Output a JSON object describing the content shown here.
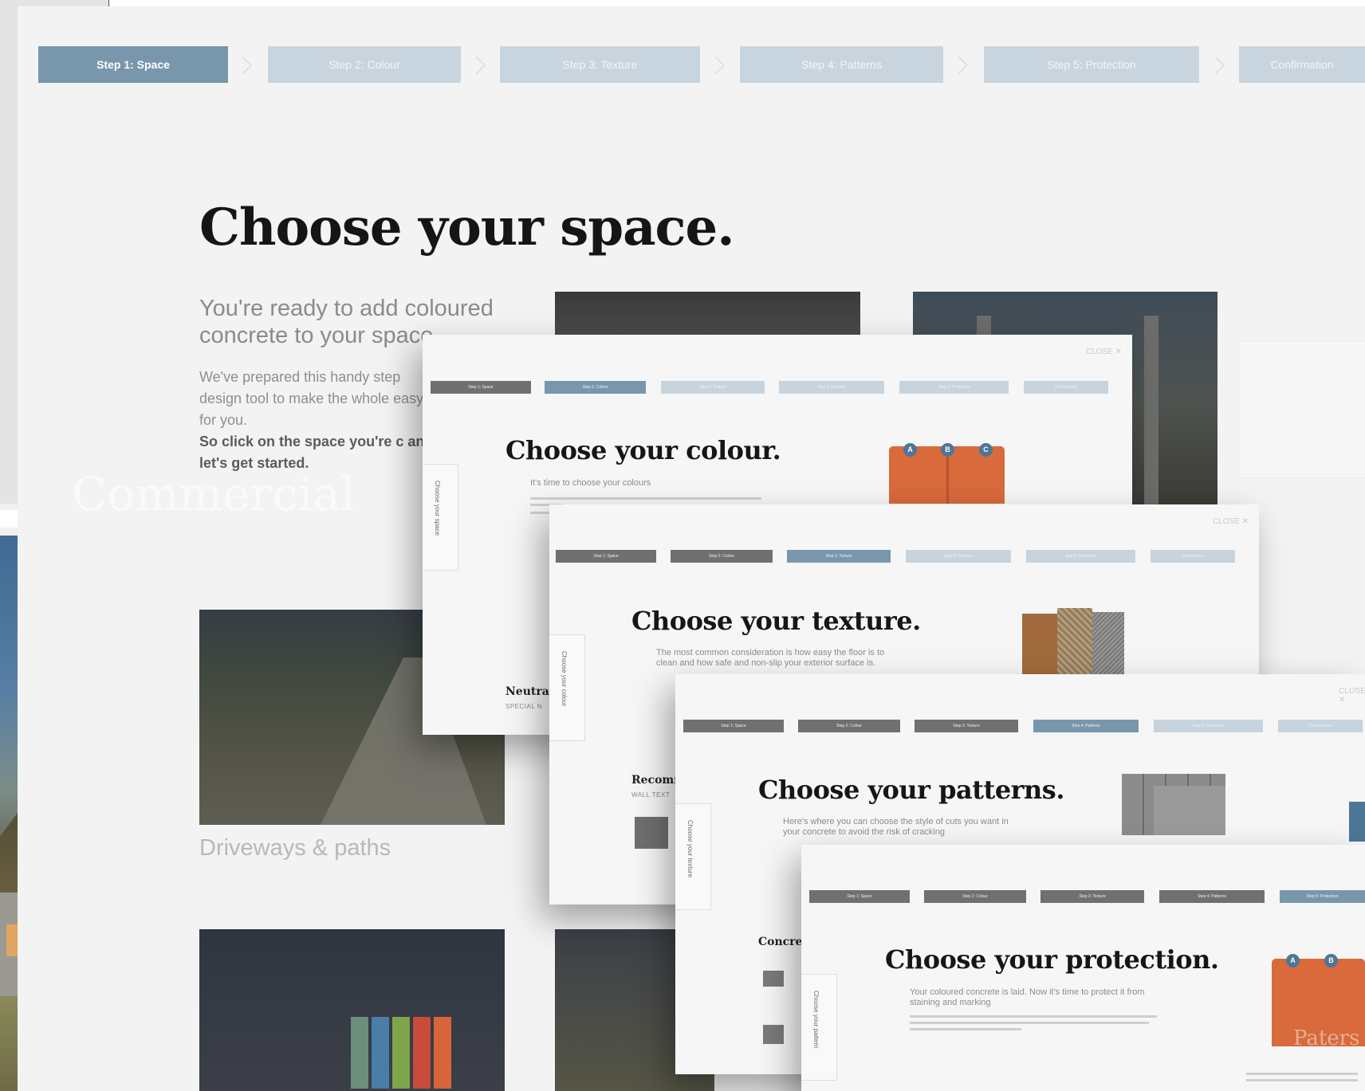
{
  "steps": [
    "Step 1: Space",
    "Step 2: Colour",
    "Step 3: Texture",
    "Step 4: Patterns",
    "Step 5: Protection",
    "Confirmation"
  ],
  "space_page": {
    "title": "Choose your space.",
    "lead": "You're ready to add coloured concrete to your space",
    "desc": "We've prepared this handy step design tool to make the whole easy for you.",
    "cta": "So click on the space you're c and let's get started.",
    "driveways_label": "Driveways & paths",
    "commercial_label": "Commercial"
  },
  "colour_card": {
    "title": "Choose your colour.",
    "lead": "It's time to choose your colours",
    "side_tab": "Choose your space",
    "sub_strong": "Neutral",
    "sub_small": "SPECIAL N",
    "close": "CLOSE",
    "bubbles": [
      "A",
      "B",
      "C"
    ]
  },
  "texture_card": {
    "title": "Choose your texture.",
    "lead": "The most common consideration is how easy the floor is to clean and how safe and non-slip your exterior surface is.",
    "side_tab": "Choose your colour",
    "sub_strong": "Recomm",
    "sub_small": "WALL TEXT",
    "close": "CLOSE"
  },
  "patterns_card": {
    "title": "Choose your patterns.",
    "lead": "Here's where you can choose the style of cuts you want in your concrete to avoid the risk of cracking",
    "side_tab": "Choose your texture",
    "sub_strong": "Concret",
    "close": "CLOSE"
  },
  "protection_card": {
    "title": "Choose your protection.",
    "lead": "Your coloured concrete is laid. Now it's time to protect it from staining and marking",
    "side_tab": "Choose your pattern",
    "watermark": "Paters",
    "bubbles": [
      "A",
      "B"
    ]
  },
  "colors": {
    "step_active": "#7897ad",
    "step_inactive": "#c9d5de",
    "step_done": "#707070",
    "orange_swatch": "#d86a3c",
    "bubble": "#4c7796"
  },
  "icons": [
    "chevron-right-icon",
    "close-icon"
  ]
}
